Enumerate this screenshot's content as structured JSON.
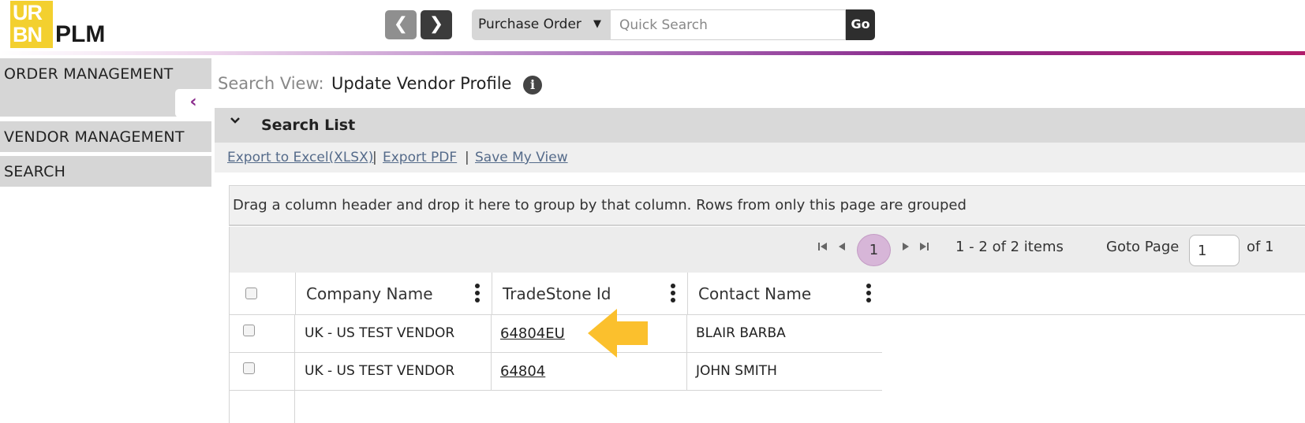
{
  "header": {
    "logo_top": "UR",
    "logo_bottom": "BN",
    "logo_text": "PLM",
    "back_glyph": "❮",
    "forward_glyph": "❯",
    "search_type": "Purchase Order",
    "search_caret": "▼",
    "search_placeholder": "Quick Search",
    "go_label": "Go"
  },
  "sidebar": {
    "items": [
      {
        "label": "ORDER MANAGEMENT"
      },
      {
        "label": "VENDOR MANAGEMENT"
      },
      {
        "label": "SEARCH"
      }
    ],
    "collapse_glyph": "‹"
  },
  "search_view": {
    "label": "Search View:",
    "title": "Update Vendor Profile",
    "info_glyph": "i"
  },
  "search_list": {
    "title": "Search List",
    "chevron": "⌄",
    "links": [
      "Export to Excel(XLSX)",
      "Export PDF",
      "Save My View"
    ],
    "separator": "|"
  },
  "grid": {
    "group_hint": "Drag a column header and drop it here to group by that column. Rows from only this page are grouped",
    "pager": {
      "first": "⏮",
      "prev": "◀",
      "current_page": "1",
      "next": "▶",
      "last": "⏭",
      "info": "1 - 2 of 2 items",
      "goto_label": "Goto Page",
      "goto_value": "1",
      "of_label": "of 1"
    },
    "columns": [
      "Company Name",
      "TradeStone Id",
      "Contact Name"
    ],
    "rows": [
      {
        "company": "UK - US TEST VENDOR",
        "tradestone_id": "64804EU",
        "contact": "BLAIR BARBA"
      },
      {
        "company": "UK - US TEST VENDOR",
        "tradestone_id": "64804",
        "contact": "JOHN SMITH"
      }
    ]
  },
  "colors": {
    "accent": "#8a2a8c",
    "logo_yellow": "#f3d02f",
    "arrow": "#fbc02d",
    "pager_highlight": "#d7b6d8"
  }
}
